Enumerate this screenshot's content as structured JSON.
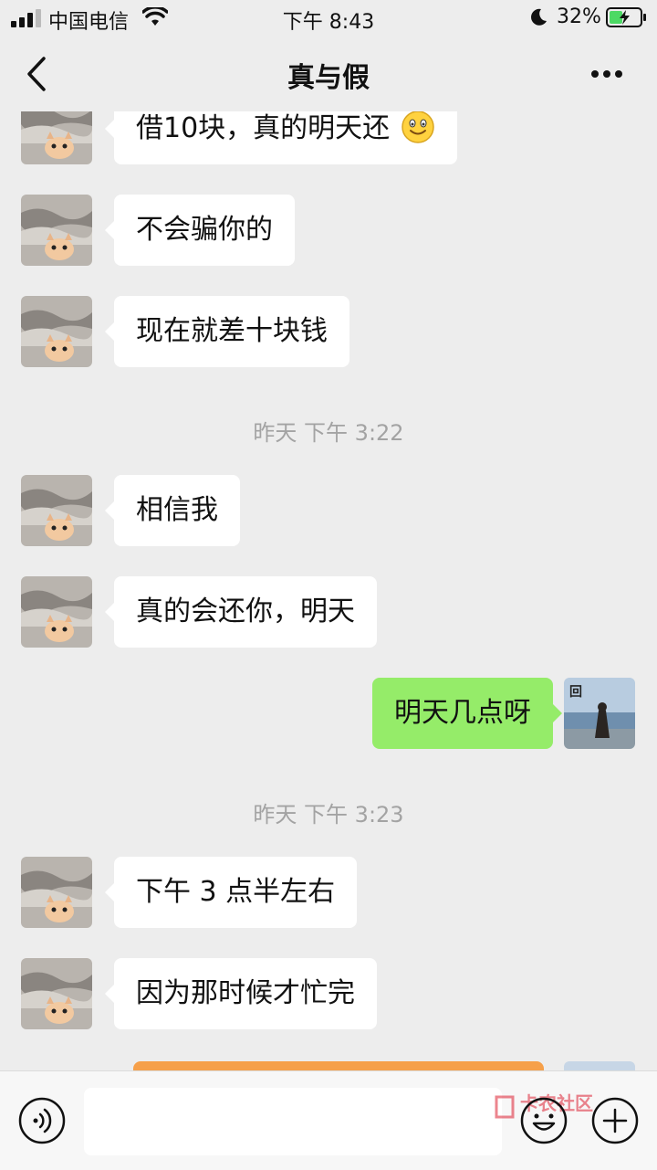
{
  "status_bar": {
    "carrier": "中国电信",
    "time": "下午 8:43",
    "battery": "32%"
  },
  "nav": {
    "title": "真与假"
  },
  "messages": [
    {
      "side": "left",
      "text": "借10块，真的明天还",
      "emoji": "smiley"
    },
    {
      "side": "left",
      "text": "不会骗你的"
    },
    {
      "side": "left",
      "text": "现在就差十块钱"
    },
    {
      "type": "timestamp",
      "text": "昨天 下午 3:22"
    },
    {
      "side": "left",
      "text": "相信我"
    },
    {
      "side": "left",
      "text": "真的会还你，明天"
    },
    {
      "side": "right",
      "text": "明天几点呀"
    },
    {
      "type": "timestamp",
      "text": "昨天 下午 3:23"
    },
    {
      "side": "left",
      "text": "下午 3 点半左右"
    },
    {
      "side": "left",
      "text": "因为那时候才忙完"
    }
  ],
  "input_bar": {
    "watermark": "卡农社区"
  },
  "colors": {
    "background": "#ededed",
    "bubble_self": "#95ec69",
    "bubble_other": "#ffffff",
    "timestamp": "#a3a3a3"
  },
  "icons": [
    "signal-icon",
    "wifi-icon",
    "moon-icon",
    "battery-icon",
    "back-icon",
    "more-icon",
    "voice-icon",
    "emoji-icon",
    "plus-icon"
  ]
}
